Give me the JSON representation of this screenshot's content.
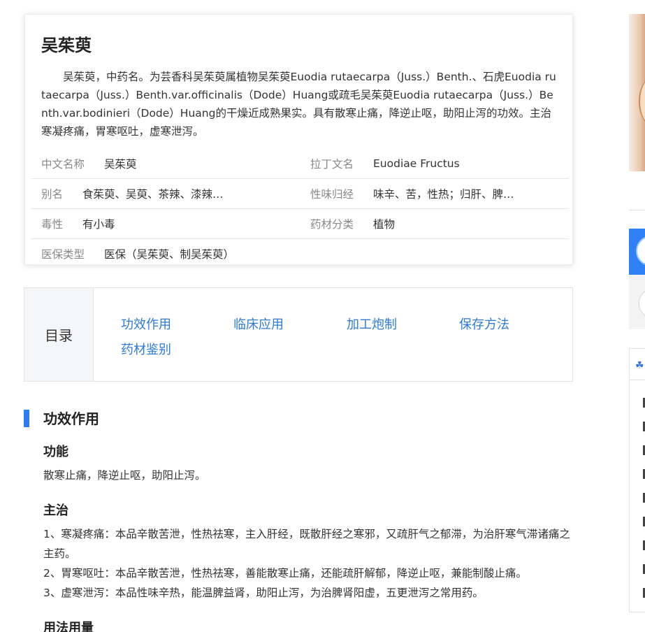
{
  "summary": {
    "title": "吴茱萸",
    "description": "吴茱萸，中药名。为芸香科吴茱萸属植物吴茱萸Euodia rutaecarpa（Juss.）Benth.、石虎Euodia rutaecarpa（Juss.）Benth.var.officinalis（Dode）Huang或疏毛吴茱萸Euodia rutaecarpa（Juss.）Benth.var.bodinieri（Dode）Huang的干燥近成熟果实。具有散寒止痛，降逆止呕，助阳止泻的功效。主治寒凝疼痛，胃寒呕吐，虚寒泄泻。",
    "info": [
      {
        "left_label": "中文名称",
        "left_value": "吴茱萸",
        "right_label": "拉丁文名",
        "right_value": "Euodiae Fructus"
      },
      {
        "left_label": "别名",
        "left_value": "食茱萸、吴萸、茶辣、漆辣…",
        "right_label": "性味归经",
        "right_value": "味辛、苦，性热；归肝、脾…"
      },
      {
        "left_label": "毒性",
        "left_value": "有小毒",
        "right_label": "药材分类",
        "right_value": "植物"
      },
      {
        "left_label": "医保类型",
        "left_value": "医保（吴茱萸、制吴茱萸）"
      }
    ]
  },
  "toc": {
    "label": "目录",
    "items": [
      "功效作用",
      "临床应用",
      "加工炮制",
      "保存方法",
      "药材鉴别"
    ]
  },
  "section": {
    "title": "功效作用",
    "function_title": "功能",
    "function_text": "散寒止痛，降逆止呕，助阳止泻。",
    "indications_title": "主治",
    "indications": [
      "1、寒凝疼痛：本品辛散苦泄，性热祛寒，主入肝经，既散肝经之寒邪，又疏肝气之郁滞，为治肝寒气滞诸痛之主药。",
      "2、胃寒呕吐：本品辛散苦泄，性热祛寒，善能散寒止痛，还能疏肝解郁，降逆止呕，兼能制酸止痛。",
      "3、虚寒泄泻：本品性味辛热，能温脾益肾，助阳止泻，为治脾肾阳虚，五更泄泻之常用药。"
    ],
    "usage_title": "用法用量"
  },
  "colors": {
    "accent": "#2b7cf5",
    "link": "#2e7ad6"
  }
}
